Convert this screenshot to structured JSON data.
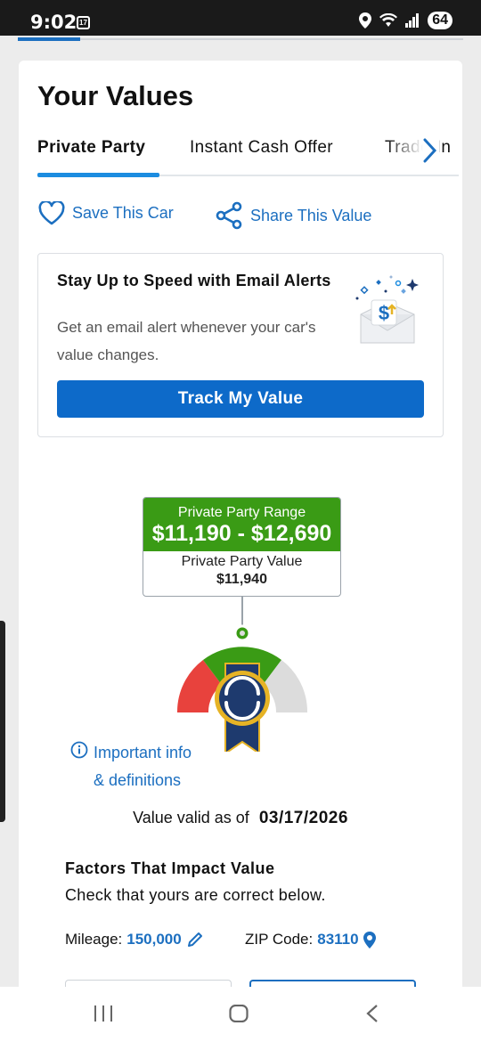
{
  "status_bar": {
    "time": "9:02",
    "calendar_day": "17",
    "battery": "64"
  },
  "page": {
    "title": "Your Values"
  },
  "tabs": [
    {
      "label": "Private Party",
      "active": true
    },
    {
      "label": "Instant Cash Offer",
      "active": false
    },
    {
      "label": "Trade-In",
      "active": false
    }
  ],
  "actions": {
    "save_label": "Save This Car",
    "share_label": "Share This Value"
  },
  "alert_card": {
    "title": "Stay Up to Speed with Email Alerts",
    "body": "Get an email alert whenever your car's value changes.",
    "button_label": "Track My Value"
  },
  "value_box": {
    "range_label": "Private Party Range",
    "range_value": "$11,190 - $12,690",
    "value_label": "Private Party Value",
    "value": "$11,940"
  },
  "gauge": {
    "colors": {
      "low": "#e8423d",
      "mid": "#3a9b15",
      "high": "#dcdcdc",
      "badge": "#1e3a6e",
      "badge_gold": "#e6b325"
    }
  },
  "info": {
    "line1": "Important info",
    "line2": "& definitions"
  },
  "valid": {
    "label": "Value valid as of",
    "date": "03/17/2026"
  },
  "factors": {
    "title": "Factors That Impact Value",
    "subtitle": "Check that yours are correct below.",
    "mileage_label": "Mileage:",
    "mileage_value": "150,000",
    "zip_label": "ZIP Code:",
    "zip_value": "83110"
  },
  "theme": {
    "accent": "#1c6fc0",
    "primary_button": "#0d6ac9",
    "green": "#3a9b15"
  }
}
